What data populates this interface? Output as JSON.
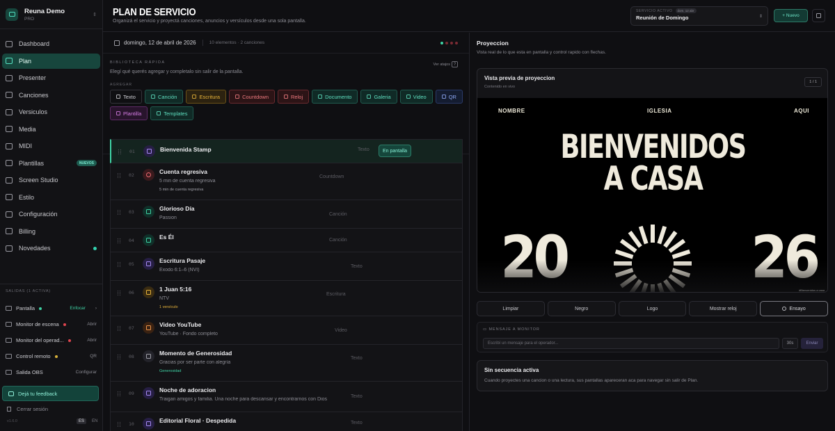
{
  "brand": {
    "name": "Reuna Demo",
    "plan": "PRO"
  },
  "nav": [
    {
      "label": "Dashboard",
      "icon": "grid-icon"
    },
    {
      "label": "Plan",
      "icon": "list-icon",
      "active": true
    },
    {
      "label": "Presenter",
      "icon": "monitor-icon"
    },
    {
      "label": "Canciones",
      "icon": "music-note-icon"
    },
    {
      "label": "Versiculos",
      "icon": "book-icon"
    },
    {
      "label": "Media",
      "icon": "image-icon"
    },
    {
      "label": "MIDI",
      "icon": "keyboard-icon"
    },
    {
      "label": "Plantillas",
      "icon": "template-icon",
      "badge": "NUEVOS"
    },
    {
      "label": "Screen Studio",
      "icon": "screen-icon"
    },
    {
      "label": "Estilo",
      "icon": "palette-icon"
    },
    {
      "label": "Configuración",
      "icon": "gear-icon"
    },
    {
      "label": "Billing",
      "icon": "card-icon"
    },
    {
      "label": "Novedades",
      "icon": "sparkle-icon",
      "dot": true
    }
  ],
  "outputs": {
    "title": "SALIDAS (1 ACTIVA)",
    "items": [
      {
        "label": "Pantalla",
        "dot": "#3fd3a5",
        "action": "Enfocar",
        "action_color": "#3fd3a5",
        "extra": "›"
      },
      {
        "label": "Monitor de escena",
        "dot": "#e0454f",
        "action": "Abrir"
      },
      {
        "label": "Monitor del operad...",
        "dot": "#e0454f",
        "action": "Abrir"
      },
      {
        "label": "Control remoto",
        "dot": "#d8b23a",
        "action": "QR"
      },
      {
        "label": "Salida OBS",
        "action": "Configurar"
      }
    ]
  },
  "feedback": "Dejá tu feedback",
  "logout": "Cerrar sesión",
  "version": "v1.6.0",
  "lang": {
    "es": "ES",
    "en": "EN"
  },
  "header": {
    "title": "PLAN DE SERVICIO",
    "subtitle": "Organizá el servicio y proyectá canciones, anuncios y versículos desde una sola pantalla.",
    "service_label": "SERVICIO ACTIVO",
    "service_date": "dom. 12 abr",
    "service_name": "Reunión de Domingo",
    "new_button": "+ Nuevo"
  },
  "plan": {
    "date": "domingo, 12 de abril de 2026",
    "count": "10 elementos · 2 canciones"
  },
  "library": {
    "title": "BIBLIOTECA RÁPIDA",
    "shortcuts": "Ver atajos",
    "shortcuts_key": "?",
    "desc": "Elegí qué querés agregar y completalo sin salir de la pantalla.",
    "add_label": "AGREGAR",
    "chips": [
      {
        "label": "Texto",
        "cls": ""
      },
      {
        "label": "Canción",
        "cls": "c-teal"
      },
      {
        "label": "Escritura",
        "cls": "c-amber"
      },
      {
        "label": "Countdown",
        "cls": "c-red"
      },
      {
        "label": "Reloj",
        "cls": "c-red"
      },
      {
        "label": "Documento",
        "cls": "c-teal"
      },
      {
        "label": "Galeria",
        "cls": "c-teal"
      },
      {
        "label": "Video",
        "cls": "c-teal"
      },
      {
        "label": "QR",
        "cls": "c-blue"
      },
      {
        "label": "Plantilla",
        "cls": "c-pink"
      },
      {
        "label": "Templates",
        "cls": "c-teal"
      }
    ]
  },
  "items": [
    {
      "num": "01",
      "name": "Bienvenida Stamp",
      "sub": "",
      "note": "",
      "type": "Texto",
      "icon_cls": "ri-purple",
      "status": "En pantalla",
      "active": true
    },
    {
      "num": "02",
      "name": "Cuenta regresiva",
      "sub": "5 min de cuenta regresiva",
      "note": "5 min de cuenta regresiva",
      "note_cls": "",
      "type": "Countdown",
      "icon_cls": "ri-red"
    },
    {
      "num": "03",
      "name": "Glorioso Día",
      "sub": "Passion",
      "note": "",
      "type": "Canción",
      "icon_cls": "ri-teal"
    },
    {
      "num": "04",
      "name": "Es Él",
      "sub": "",
      "note": "",
      "type": "Canción",
      "icon_cls": "ri-teal"
    },
    {
      "num": "05",
      "name": "Escritura Pasaje",
      "sub": "Éxodo 6:1–6 (NVI)",
      "note": "",
      "type": "Texto",
      "icon_cls": "ri-purple"
    },
    {
      "num": "06",
      "name": "1 Juan 5:16",
      "sub": "NTV",
      "note": "1 versículo",
      "note_cls": "amb",
      "type": "Escritura",
      "icon_cls": "ri-amber"
    },
    {
      "num": "07",
      "name": "Video YouTube",
      "sub": "YouTube · Fondo completo",
      "note": "",
      "type": "Video",
      "icon_cls": "ri-orange"
    },
    {
      "num": "08",
      "name": "Momento de Generosidad",
      "sub": "Gracias por ser parte con alegría",
      "note": "Generosidad",
      "note_cls": "grn",
      "type": "Texto",
      "icon_cls": ""
    },
    {
      "num": "09",
      "name": "Noche de adoracion",
      "sub": "Traigan amigos y familia. Una noche para descansar y encontrarnos con Dios",
      "note": "",
      "type": "Texto",
      "icon_cls": "ri-purple"
    },
    {
      "num": "10",
      "name": "Editorial Floral · Despedida",
      "sub": "",
      "note": "",
      "type": "Texto",
      "icon_cls": "ri-purple"
    }
  ],
  "projection": {
    "title": "Proyeccion",
    "desc": "Vista real de lo que esta en pantalla y control rapido con flechas.",
    "preview_title": "Vista previa de proyeccion",
    "preview_sub": "Contenido en vivo",
    "page": "1 / 1",
    "slide": {
      "left": "NOMBRE",
      "center": "IGLESIA",
      "right": "AQUI",
      "line1": "BIENVENIDOS",
      "line2": "A CASA",
      "year_left": "20",
      "year_right": "26",
      "caption": "#Bienvenidos a casa"
    },
    "controls": [
      "Limpiar",
      "Negro",
      "Logo",
      "Mostrar reloj",
      "Ensayo"
    ]
  },
  "message": {
    "label": "MENSAJE A MONITOR",
    "placeholder": "Escribí un mensaje para el operador...",
    "seconds": "30s",
    "send": "Enviar"
  },
  "sequence": {
    "title": "Sin secuencia activa",
    "desc": "Cuando proyectes una cancion o una lectura, sus pantallas apareceran aca para navegar sin salir de Plan."
  }
}
